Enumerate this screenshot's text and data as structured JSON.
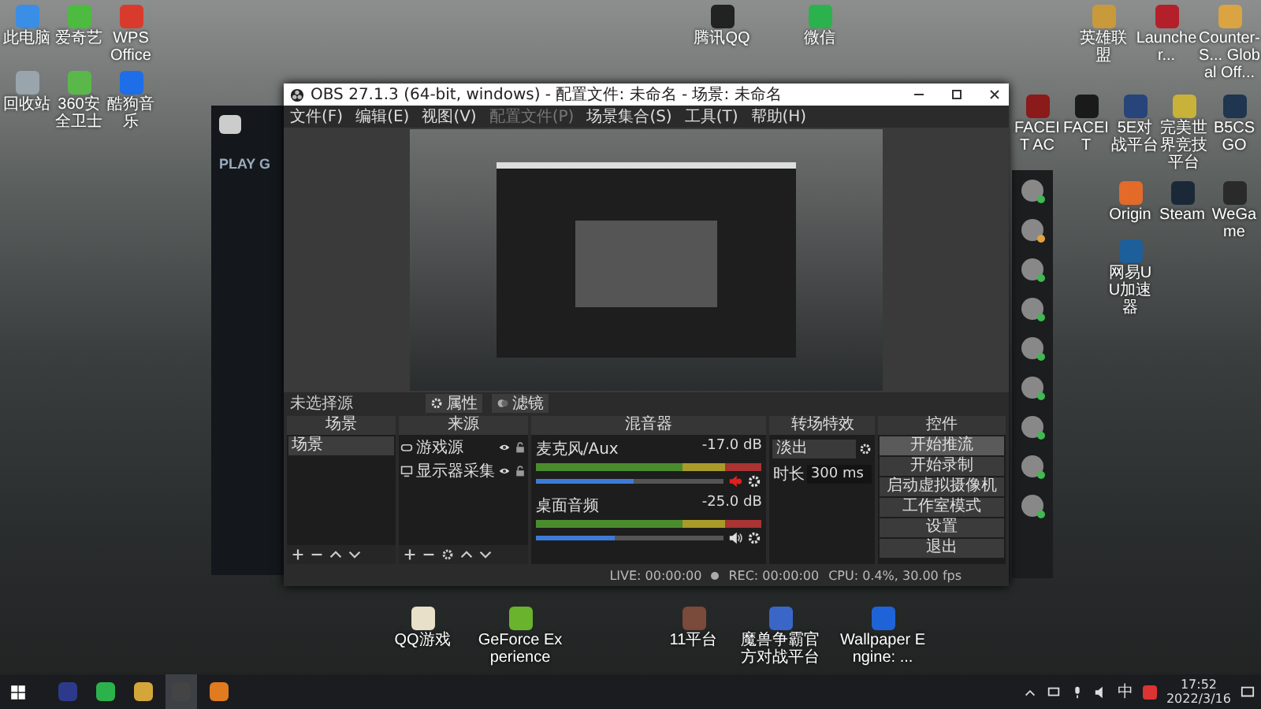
{
  "desktop_icons": [
    {
      "label": "此电脑"
    },
    {
      "label": "爱奇艺"
    },
    {
      "label": "WPS Office"
    },
    {
      "label": "回收站"
    },
    {
      "label": "360安全卫士"
    },
    {
      "label": "酷狗音乐"
    },
    {
      "label": "腾讯QQ"
    },
    {
      "label": "微信"
    },
    {
      "label": "英雄联盟"
    },
    {
      "label": "Launcher..."
    },
    {
      "label": "Counter-S... Global Off..."
    },
    {
      "label": "FACEIT AC"
    },
    {
      "label": "FACEIT"
    },
    {
      "label": "5E对战平台"
    },
    {
      "label": "完美世界竞技平台"
    },
    {
      "label": "B5CSGO"
    },
    {
      "label": "Origin"
    },
    {
      "label": "Steam"
    },
    {
      "label": "WeGame"
    },
    {
      "label": "网易UU加速器"
    },
    {
      "label": "QQ游戏"
    },
    {
      "label": "GeForce Experience"
    },
    {
      "label": "11平台"
    },
    {
      "label": "魔兽争霸官方对战平台"
    },
    {
      "label": "Wallpaper Engine: ..."
    }
  ],
  "launcher": {
    "banner": "PLAY G"
  },
  "friends": [
    {
      "color": "#3fb950"
    },
    {
      "color": "#e3a33a"
    },
    {
      "color": "#3fb950"
    },
    {
      "color": "#3fb950"
    },
    {
      "color": "#3fb950"
    },
    {
      "color": "#3fb950"
    },
    {
      "color": "#3fb950"
    },
    {
      "color": "#3fb950"
    },
    {
      "color": "#3fb950"
    }
  ],
  "obs": {
    "title": "OBS 27.1.3 (64-bit, windows) - 配置文件: 未命名 - 场景: 未命名",
    "menu": [
      {
        "label": "文件(F)",
        "disabled": false
      },
      {
        "label": "编辑(E)",
        "disabled": false
      },
      {
        "label": "视图(V)",
        "disabled": false
      },
      {
        "label": "配置文件(P)",
        "disabled": true
      },
      {
        "label": "场景集合(S)",
        "disabled": false
      },
      {
        "label": "工具(T)",
        "disabled": false
      },
      {
        "label": "帮助(H)",
        "disabled": false
      }
    ],
    "source_bar": {
      "label": "未选择源",
      "buttons": [
        {
          "kind": "gear",
          "label": "属性"
        },
        {
          "kind": "filter",
          "label": "滤镜"
        }
      ]
    },
    "scenes": {
      "title": "场景",
      "items": [
        {
          "label": "场景",
          "selected": true
        }
      ]
    },
    "sources": {
      "title": "来源",
      "items": [
        {
          "kind": "game",
          "label": "游戏源"
        },
        {
          "kind": "monitor",
          "label": "显示器采集"
        }
      ]
    },
    "mixer": {
      "title": "混音器",
      "channels": [
        {
          "name": "麦克风/Aux",
          "reading": "-17.0 dB",
          "level": 0.52,
          "muted": true
        },
        {
          "name": "桌面音频",
          "reading": "-25.0 dB",
          "level": 0.42,
          "muted": false
        }
      ]
    },
    "transitions": {
      "title": "转场特效",
      "selected": "淡出",
      "duration_label": "时长",
      "duration": "300 ms"
    },
    "controls": {
      "title": "控件",
      "buttons": [
        {
          "label": "开始推流",
          "selected": true
        },
        {
          "label": "开始录制",
          "selected": false
        },
        {
          "label": "启动虚拟摄像机",
          "selected": false
        },
        {
          "label": "工作室模式",
          "selected": false
        },
        {
          "label": "设置",
          "selected": false
        },
        {
          "label": "退出",
          "selected": false
        }
      ]
    },
    "status": {
      "live": "LIVE: 00:00:00",
      "rec": "REC: 00:00:00",
      "cpu": "CPU: 0.4%, 30.00 fps"
    }
  },
  "taskbar": {
    "apps": [
      {
        "selected": false
      },
      {
        "selected": false
      },
      {
        "selected": false
      },
      {
        "selected": true
      },
      {
        "selected": false
      }
    ],
    "ime": "中",
    "time": "17:52",
    "date": "2022/3/16"
  }
}
